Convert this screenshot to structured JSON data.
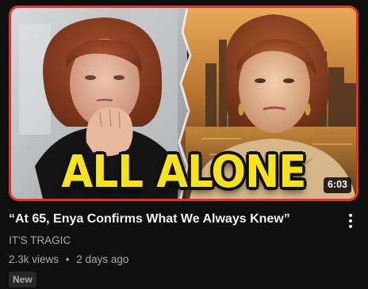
{
  "video": {
    "thumbnail_text": "ALL ALONE",
    "duration": "6:03",
    "title": "“At 65, Enya Confirms What We Always Knew”",
    "channel": "IT'S TRAGIC",
    "views": "2.3k views",
    "separator": "•",
    "age": "2 days ago",
    "badge": "New"
  },
  "icons": {
    "menu": "more-vert-icon"
  },
  "colors": {
    "background": "#0f0f0f",
    "thumbnail_border": "#e0342a",
    "headline": "#f7e21b",
    "title_text": "#f1f1f1",
    "secondary_text": "#aaaaaa",
    "badge_bg": "#272727"
  }
}
